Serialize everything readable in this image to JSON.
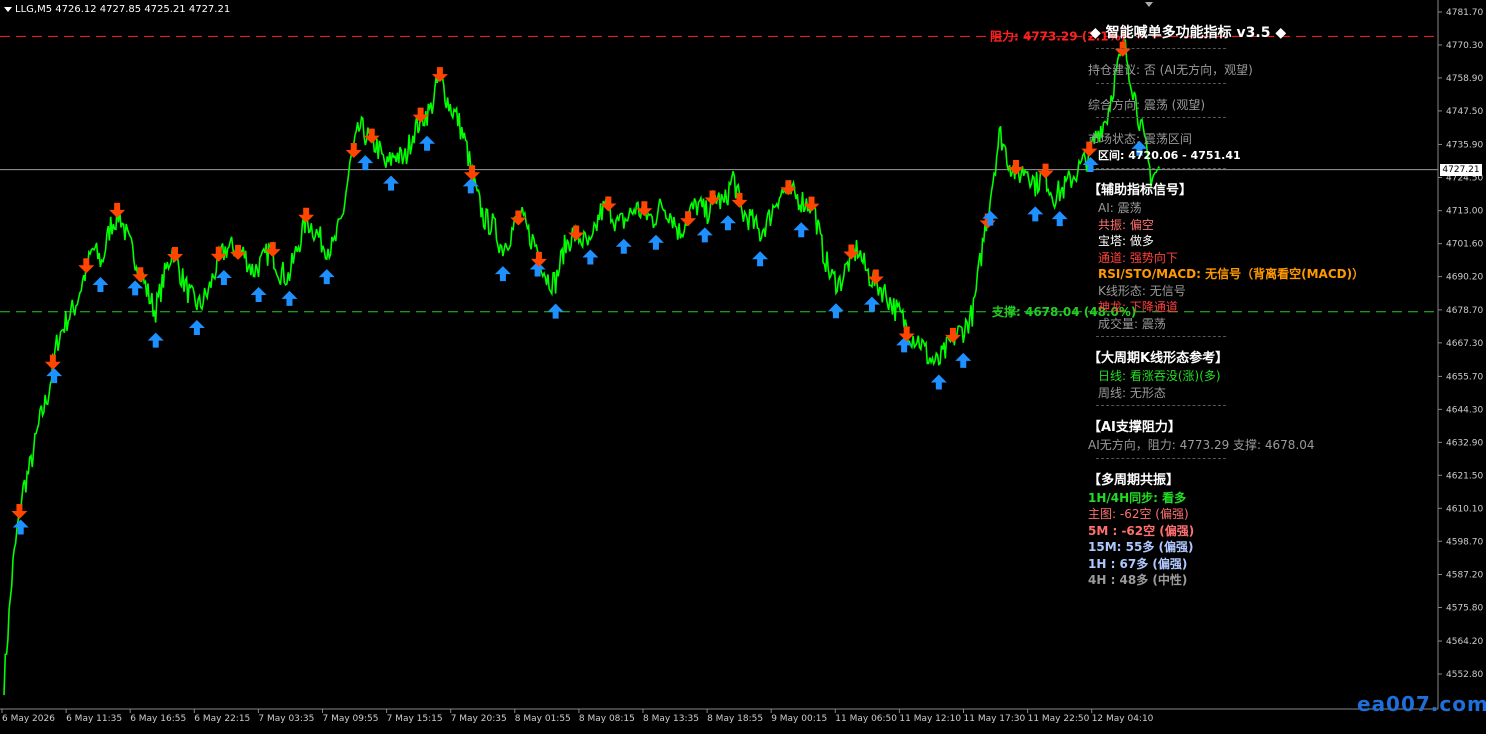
{
  "header": {
    "symbol": "LLG,M5",
    "ohlc": "4726.12 4727.85 4725.21 4727.21"
  },
  "axis": {
    "price_ticks": [
      "4781.70",
      "4770.30",
      "4758.90",
      "4747.50",
      "4735.90",
      "4724.50",
      "4713.00",
      "4701.60",
      "4690.20",
      "4678.70",
      "4667.30",
      "4655.70",
      "4644.30",
      "4632.90",
      "4621.50",
      "4610.10",
      "4598.70",
      "4587.20",
      "4575.80",
      "4564.20",
      "4552.80"
    ],
    "time_ticks": [
      "6 May 2026",
      "6 May 11:35",
      "6 May 16:55",
      "6 May 22:15",
      "7 May 03:35",
      "7 May 09:55",
      "7 May 15:15",
      "7 May 20:35",
      "8 May 01:55",
      "8 May 08:15",
      "8 May 13:35",
      "8 May 18:55",
      "9 May 00:15",
      "11 May 06:50",
      "11 May 12:10",
      "11 May 17:30",
      "11 May 22:50",
      "12 May 04:10"
    ],
    "current_price": "4727.21"
  },
  "levels": {
    "resistance_label": "阻力: 4773.29 (2.1%)",
    "support_label": "支撑: 4678.04 (48.0%)"
  },
  "panel": {
    "title": "◆ 智能喊单多功能指标 v3.5 ◆",
    "holding": "持仓建议: 否 (AI无方向，观望)",
    "overall": "综合方向: 震荡 (观望)",
    "market": "市场状态: 震荡区间",
    "range": "区间: 4720.06 - 4751.41",
    "aux_header": "【辅助指标信号】",
    "ai": "AI: 震荡",
    "resonance": "共振: 偏空",
    "baota": "宝塔: 做多",
    "channel": "通道: 强势向下",
    "rsi": "RSI/STO/MACD: 无信号（背离看空(MACD)）",
    "kline": "K线形态: 无信号",
    "shenlong": "神龙: 下降通道",
    "volume": "成交量: 震荡",
    "big_header": "【大周期K线形态参考】",
    "daily": "日线: 看涨吞没(涨)(多)",
    "weekly": "周线: 无形态",
    "ai_sr_header": "【AI支撑阻力】",
    "ai_sr": "AI无方向，阻力: 4773.29   支撑: 4678.04",
    "multi_header": "【多周期共振】",
    "sync": "1H/4H同步: 看多",
    "main": "主图: -62空 (偏强)",
    "m5": "5M : -62空 (偏强)",
    "m15": "15M: 55多 (偏强)",
    "h1": "1H : 67多 (偏强)",
    "h4": "4H : 48多 (中性)"
  },
  "colors": {
    "price_line": "#00ff00",
    "resistance": "#ff2020",
    "support": "#22cc22",
    "buy_arrow": "#1e90ff",
    "sell_arrow": "#ff4500",
    "grey_text": "#9a9a9a",
    "red_text": "#ff4040",
    "orange_text": "#ff9900",
    "green_text": "#22dd22",
    "pink_text": "#ff7070",
    "light_blue_text": "#b0c8ff"
  },
  "watermark": "ea007.com",
  "chart_data": {
    "type": "line",
    "series": [
      {
        "values": [
          4550,
          4590,
          4615,
          4625,
          4640,
          4650,
          4668,
          4675,
          4680,
          4690,
          4700,
          4695,
          4708,
          4712,
          4702,
          4695,
          4686,
          4678,
          4690,
          4700,
          4690,
          4683,
          4680,
          4685,
          4695,
          4700,
          4700,
          4698,
          4692,
          4695,
          4700,
          4692,
          4690,
          4700,
          4710,
          4706,
          4701,
          4700,
          4710,
          4730,
          4742,
          4738,
          4735,
          4728,
          4733,
          4730,
          4740,
          4745,
          4748,
          4760,
          4750,
          4745,
          4735,
          4720,
          4710,
          4708,
          4700,
          4705,
          4712,
          4705,
          4700,
          4690,
          4688,
          4700,
          4705,
          4703,
          4700,
          4712,
          4715,
          4708,
          4710,
          4714,
          4712,
          4710,
          4715,
          4712,
          4705,
          4712,
          4715,
          4712,
          4718,
          4715,
          4725,
          4712,
          4710,
          4705,
          4710,
          4718,
          4720,
          4718,
          4716,
          4715,
          4700,
          4690,
          4688,
          4695,
          4700,
          4692,
          4688,
          4685,
          4680,
          4676,
          4670,
          4668,
          4662,
          4660,
          4665,
          4670,
          4672,
          4678,
          4700,
          4720,
          4740,
          4730,
          4725,
          4728,
          4722,
          4726,
          4718,
          4720,
          4724,
          4728,
          4732,
          4740,
          4745,
          4760,
          4770,
          4755,
          4740,
          4725,
          4727
        ]
      }
    ],
    "ylim": [
      4547,
      4784
    ]
  }
}
